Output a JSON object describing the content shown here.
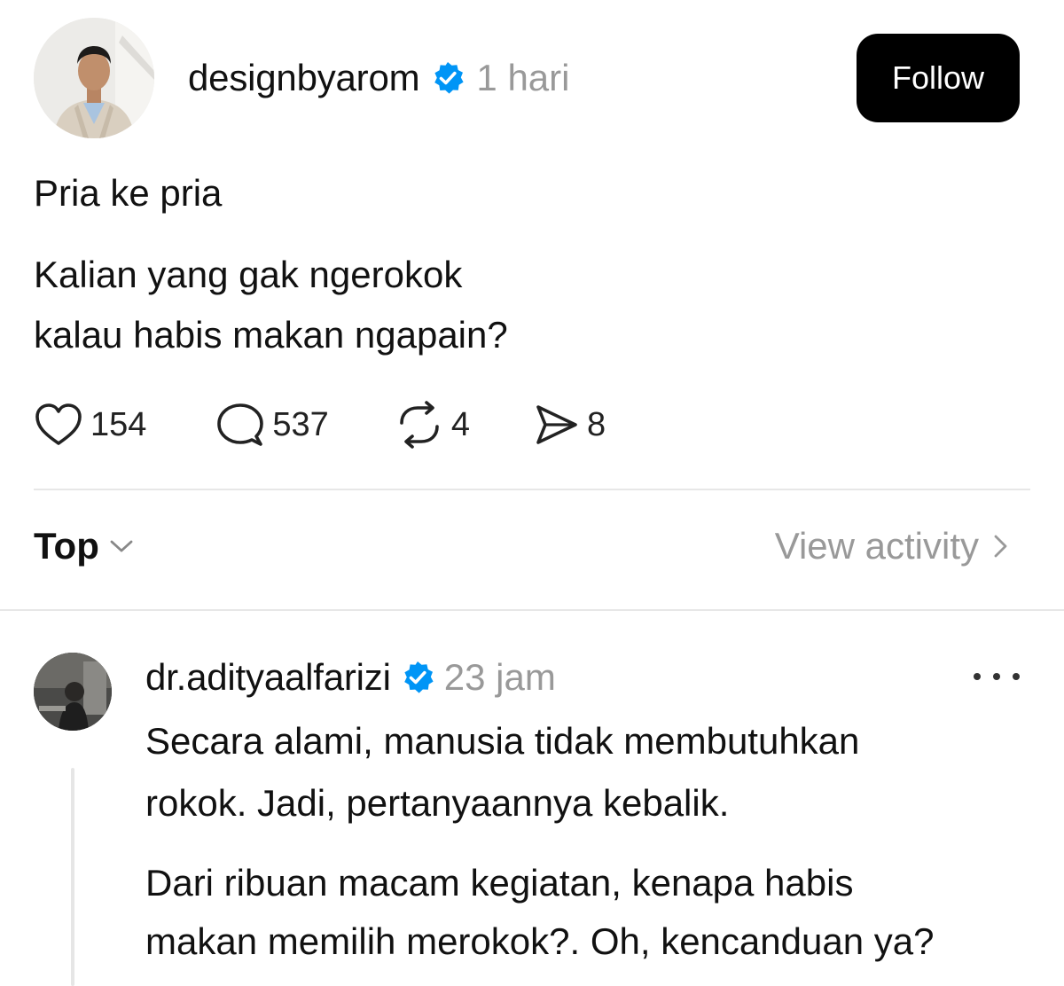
{
  "post": {
    "author": "designbyarom",
    "verified_icon": "verified-badge-icon",
    "time": "1 hari",
    "follow_label": "Follow",
    "text_lines": [
      "Pria ke pria",
      "Kalian yang gak ngerokok",
      "kalau habis makan ngapain?"
    ],
    "likes": "154",
    "comments": "537",
    "reposts": "4",
    "shares": "8"
  },
  "sort": {
    "label": "Top",
    "view_activity": "View activity"
  },
  "reply": {
    "author": "dr.adityaalfarizi",
    "time": "23 jam",
    "text_lines": [
      "Secara alami, manusia tidak membutuhkan",
      "rokok. Jadi, pertanyaannya kebalik.",
      "Dari ribuan macam kegiatan, kenapa habis",
      "makan memilih merokok?. Oh, kencanduan ya?"
    ]
  },
  "colors": {
    "verified": "#0095f6",
    "muted_text": "#999999",
    "button_bg": "#000000"
  }
}
